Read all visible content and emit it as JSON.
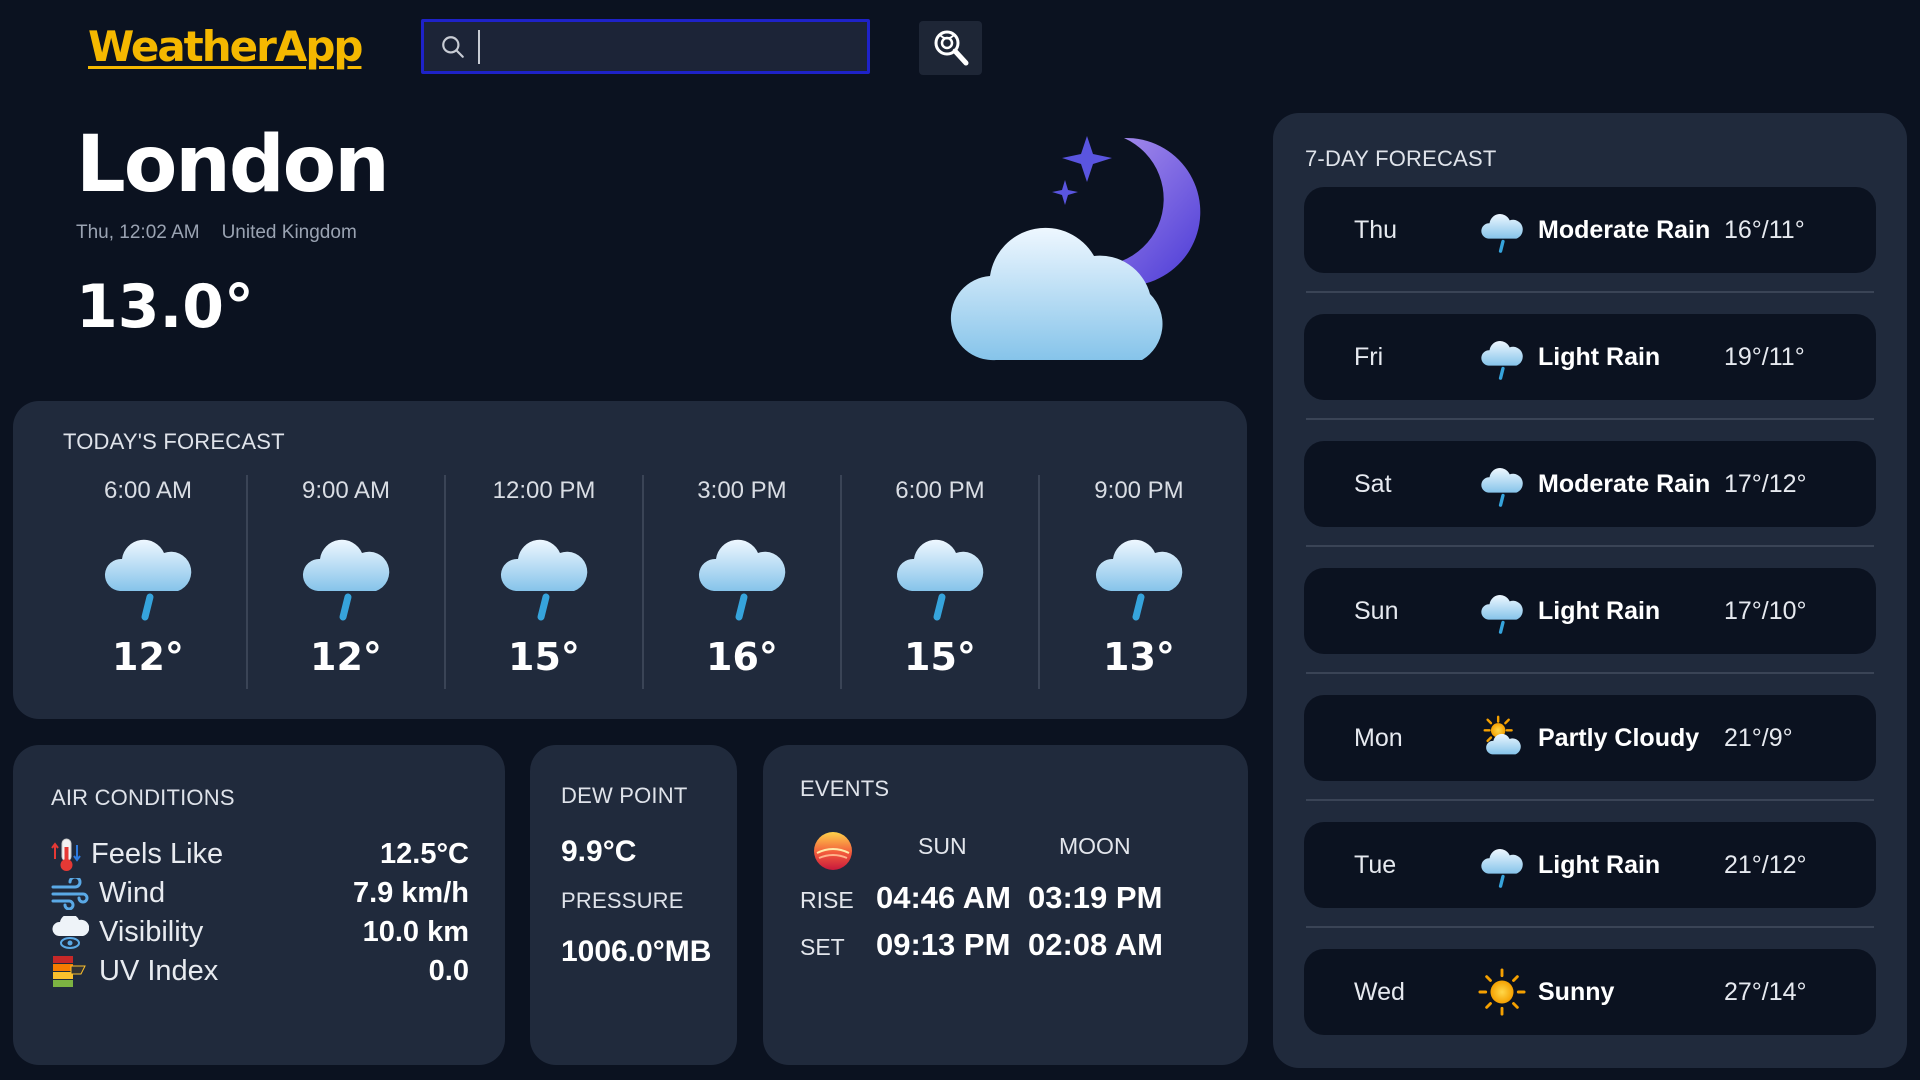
{
  "header": {
    "logo": "WeatherApp",
    "search": {
      "value": "",
      "placeholder": ""
    },
    "search_icon": "search-icon",
    "locate_icon": "location-search-icon"
  },
  "current": {
    "city": "London",
    "time": "Thu, 12:02 AM",
    "country": "United Kingdom",
    "temp": "13.0°",
    "icon": "cloudy-night-icon"
  },
  "today": {
    "title": "TODAY'S FORECAST",
    "hours": [
      {
        "time": "6:00 AM",
        "temp": "12°",
        "icon": "rain-icon"
      },
      {
        "time": "9:00 AM",
        "temp": "12°",
        "icon": "rain-icon"
      },
      {
        "time": "12:00 PM",
        "temp": "15°",
        "icon": "rain-icon"
      },
      {
        "time": "3:00 PM",
        "temp": "16°",
        "icon": "rain-icon"
      },
      {
        "time": "6:00 PM",
        "temp": "15°",
        "icon": "rain-icon"
      },
      {
        "time": "9:00 PM",
        "temp": "13°",
        "icon": "rain-icon"
      }
    ]
  },
  "air": {
    "title": "AIR CONDITIONS",
    "rows": [
      {
        "label": "Feels Like",
        "value": "12.5°C",
        "icon": "thermometer-icon"
      },
      {
        "label": "Wind",
        "value": "7.9 km/h",
        "icon": "wind-icon"
      },
      {
        "label": "Visibility",
        "value": "10.0 km",
        "icon": "visibility-icon"
      },
      {
        "label": "UV Index",
        "value": "0.0",
        "icon": "uv-index-icon"
      }
    ]
  },
  "dew": {
    "title": "DEW POINT",
    "value": "9.9°C",
    "pressure_title": "PRESSURE",
    "pressure_value": "1006.0°MB"
  },
  "events": {
    "title": "EVENTS",
    "sun_label": "SUN",
    "moon_label": "MOON",
    "rise_label": "RISE",
    "set_label": "SET",
    "sun_rise": "04:46 AM",
    "moon_rise": "03:19 PM",
    "sun_set": "09:13 PM",
    "moon_set": "02:08 AM"
  },
  "week": {
    "title": "7-DAY FORECAST",
    "days": [
      {
        "day": "Thu",
        "condition": "Moderate Rain",
        "temp": "16°/11°",
        "icon": "rain-icon"
      },
      {
        "day": "Fri",
        "condition": "Light Rain",
        "temp": "19°/11°",
        "icon": "rain-icon"
      },
      {
        "day": "Sat",
        "condition": "Moderate Rain",
        "temp": "17°/12°",
        "icon": "rain-icon"
      },
      {
        "day": "Sun",
        "condition": "Light Rain",
        "temp": "17°/10°",
        "icon": "rain-icon"
      },
      {
        "day": "Mon",
        "condition": "Partly Cloudy",
        "temp": "21°/9°",
        "icon": "partly-cloudy-icon"
      },
      {
        "day": "Tue",
        "condition": "Light Rain",
        "temp": "21°/12°",
        "icon": "rain-icon"
      },
      {
        "day": "Wed",
        "condition": "Sunny",
        "temp": "27°/14°",
        "icon": "sun-icon"
      }
    ]
  },
  "colors": {
    "background": "#0b1220",
    "card": "#202a3c",
    "accent": "#f5b800",
    "search_border": "#1e22c8"
  }
}
